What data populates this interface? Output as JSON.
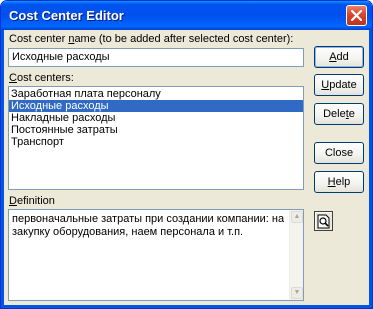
{
  "window": {
    "title": "Cost Center Editor"
  },
  "name_field": {
    "label_prefix": "Cost center ",
    "label_hotkey": "n",
    "label_suffix": "ame (to be added after selected cost center):",
    "value": "Исходные расходы"
  },
  "cost_centers": {
    "label_hotkey": "C",
    "label_suffix": "ost centers:",
    "items": [
      {
        "label": "Заработная плата персоналу",
        "selected": false
      },
      {
        "label": "Исходные расходы",
        "selected": true
      },
      {
        "label": "Накладные расходы",
        "selected": false
      },
      {
        "label": "Постоянные затраты",
        "selected": false
      },
      {
        "label": "Транспорт",
        "selected": false
      }
    ]
  },
  "buttons": {
    "add_hotkey": "A",
    "add_rest": "dd",
    "update_hotkey": "U",
    "update_rest": "pdate",
    "delete_prefix": "Dele",
    "delete_hotkey": "t",
    "delete_rest": "e",
    "close_label": "Close",
    "help_hotkey": "H",
    "help_rest": "elp"
  },
  "definition": {
    "label_hotkey": "D",
    "label_suffix": "efinition",
    "value": "первоначальные затраты при создании компании: на закупку оборудования, наем персонала и т.п."
  },
  "icons": {
    "close": "close-x-icon",
    "preview": "magnifier-preview-icon"
  }
}
